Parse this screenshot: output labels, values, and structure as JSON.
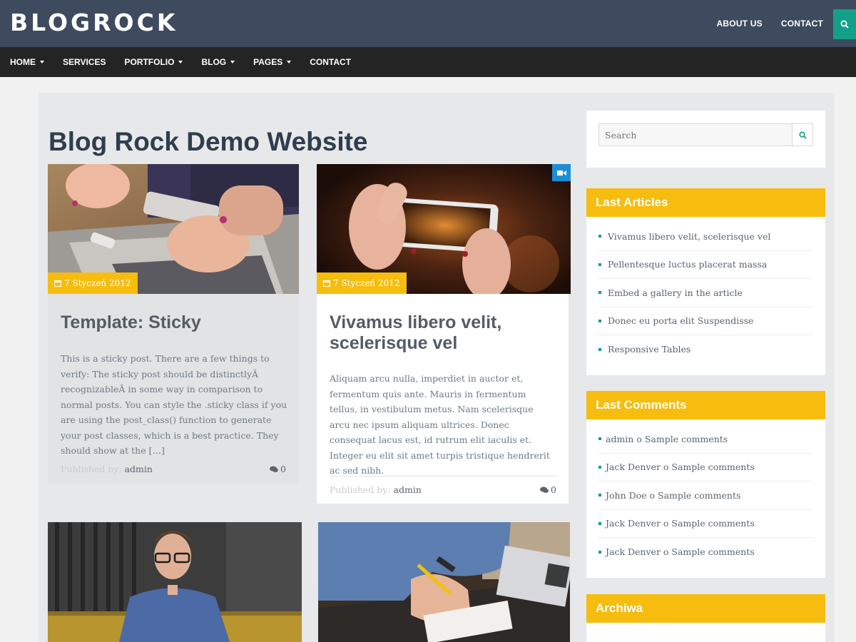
{
  "header": {
    "logo": "BLOGROCK",
    "top_links": [
      "ABOUT US",
      "CONTACT"
    ]
  },
  "nav": {
    "items": [
      {
        "label": "HOME",
        "dropdown": true
      },
      {
        "label": "SERVICES",
        "dropdown": false
      },
      {
        "label": "PORTFOLIO",
        "dropdown": true
      },
      {
        "label": "BLOG",
        "dropdown": true
      },
      {
        "label": "PAGES",
        "dropdown": true
      },
      {
        "label": "CONTACT",
        "dropdown": false
      }
    ]
  },
  "page": {
    "title": "Blog Rock Demo Website"
  },
  "posts": [
    {
      "date": "7 Styczeń 2012",
      "title": "Template: Sticky",
      "excerpt": "This is a sticky post. There are a few things to verify: The sticky post should be distinctlyÂ recognizableÂ in some way in comparison to normal posts. You can style the .sticky class if you are using the post_class() function to generate your post classes, which is a best practice. They should show at the […]",
      "published_label": "Published by:",
      "author": "admin",
      "comments": "0"
    },
    {
      "date": "7 Styczeń 2012",
      "title": "Vivamus libero velit, scelerisque vel",
      "excerpt": "Aliquam arcu nulla, imperdiet in auctor et, fermentum quis ante. Mauris in fermentum tellus, in vestibulum metus. Nam scelerisque arcu nec ipsum aliquam ultrices. Donec consequat lacus est, id rutrum elit iaculis et. Integer eu elit sit amet turpis tristique hendrerit ac sed nibh.",
      "published_label": "Published by:",
      "author": "admin",
      "comments": "0"
    }
  ],
  "sidebar": {
    "search_placeholder": "Search",
    "last_articles": {
      "title": "Last Articles",
      "items": [
        "Vivamus libero velit, scelerisque vel",
        "Pellentesque luctus placerat massa",
        "Embed a gallery in the article",
        "Donec eu porta elit Suspendisse",
        "Responsive Tables"
      ]
    },
    "last_comments": {
      "title": "Last Comments",
      "items": [
        "admin o Sample comments",
        "Jack Denver o Sample comments",
        "John Doe o Sample comments",
        "Jack Denver o Sample comments",
        "Jack Denver o Sample comments"
      ]
    },
    "archives": {
      "title": "Archiwa"
    }
  },
  "colors": {
    "header_bg": "#3e4a5e",
    "nav_bg": "#242424",
    "accent_yellow": "#f6bd0f",
    "accent_teal": "#13a089",
    "title_color": "#2f3d4f"
  }
}
